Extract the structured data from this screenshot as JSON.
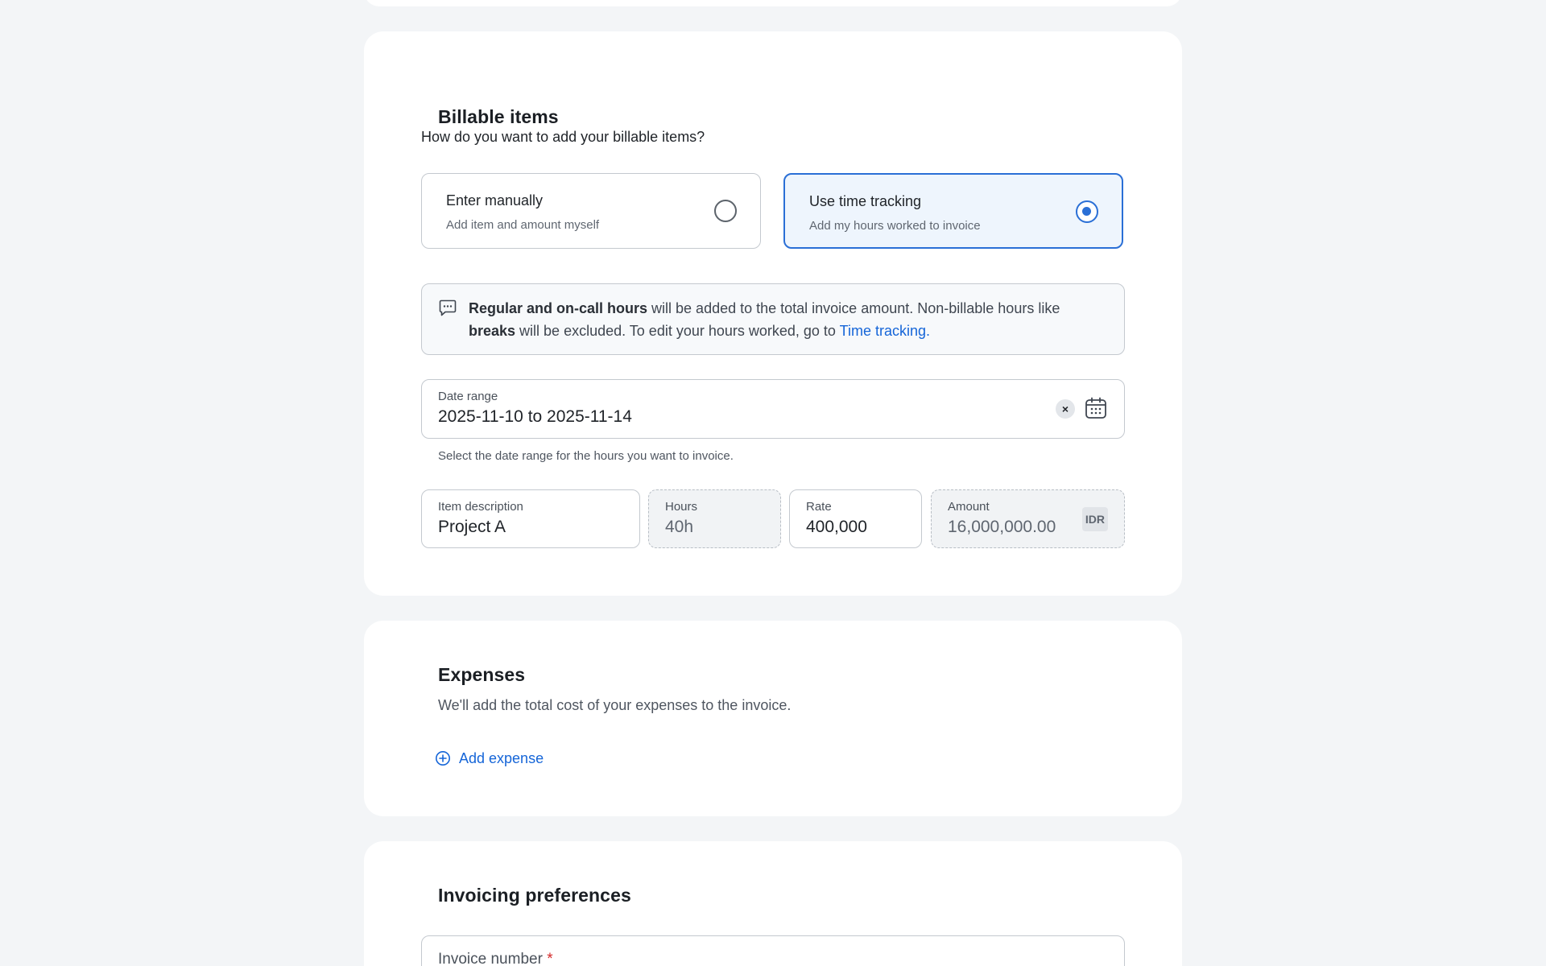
{
  "billable": {
    "title": "Billable items",
    "question": "How do you want to add your billable items?",
    "options": [
      {
        "title": "Enter manually",
        "subtitle": "Add item and amount myself",
        "selected": false
      },
      {
        "title": "Use time tracking",
        "subtitle": "Add my hours worked to invoice",
        "selected": true
      }
    ],
    "info": {
      "bold1": "Regular and on-call hours",
      "text1": " will be added to the total invoice amount. Non-billable hours like ",
      "bold2": "breaks",
      "text2": " will be excluded. To edit your hours worked, go to ",
      "link": "Time tracking."
    },
    "date_range": {
      "label": "Date range",
      "value": "2025-11-10 to 2025-11-14",
      "clear": "×",
      "helper": "Select the date range for the hours you want to invoice."
    },
    "item": {
      "description_label": "Item description",
      "description_value": "Project A",
      "hours_label": "Hours",
      "hours_value": "40h",
      "rate_label": "Rate",
      "rate_value": "400,000",
      "amount_label": "Amount",
      "amount_value": "16,000,000.00",
      "currency": "IDR"
    }
  },
  "expenses": {
    "title": "Expenses",
    "subtitle": "We'll add the total cost of your expenses to the invoice.",
    "add_label": "Add expense"
  },
  "preferences": {
    "title": "Invoicing preferences",
    "invoice_number_label": "Invoice number",
    "required_mark": "*"
  },
  "colors": {
    "accent": "#2a6fd6",
    "link": "#1565d8",
    "page_bg": "#f3f5f7",
    "selected_bg": "#eef5fd"
  }
}
